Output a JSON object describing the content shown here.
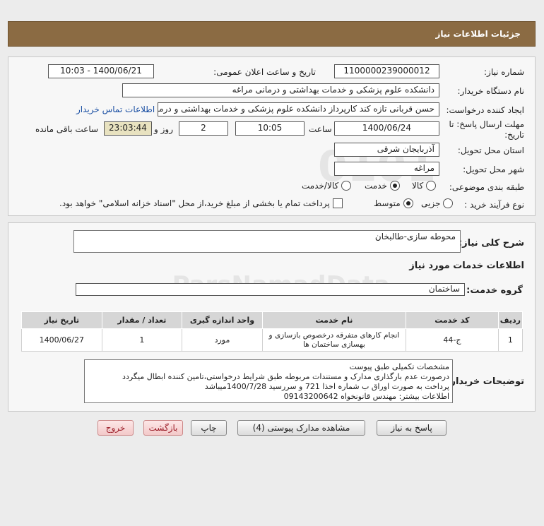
{
  "header": {
    "title": "جزئیات اطلاعات نیاز"
  },
  "form": {
    "need_number": {
      "label": "شماره نیاز:",
      "value": "1100000239000012"
    },
    "announce_date": {
      "label": "تاریخ و ساعت اعلان عمومی:",
      "value": "1400/06/21 - 10:03"
    },
    "buyer_org": {
      "label": "نام دستگاه خریدار:",
      "value": "دانشکده علوم پزشکی و خدمات بهداشتی و درمانی مراغه"
    },
    "requester": {
      "label": "ایجاد کننده درخواست:",
      "value": "حسن قربانی تازه کند کارپرداز دانشکده علوم پزشکی و خدمات بهداشتی و درمانی مراغه",
      "contact_link": "اطلاعات تماس خریدار"
    },
    "deadline": {
      "label": "مهلت ارسال پاسخ: تا تاریخ:",
      "date": "1400/06/24",
      "time_label": "ساعت",
      "time": "10:05",
      "days": "2",
      "days_label": "روز و",
      "remaining": "23:03:44",
      "remaining_label": "ساعت باقی مانده"
    },
    "province": {
      "label": "استان محل تحویل:",
      "value": "آذربایجان شرقی"
    },
    "city": {
      "label": "شهر محل تحویل:",
      "value": "مراغه"
    },
    "category": {
      "label": "طبقه بندی موضوعی:",
      "options": [
        "کالا",
        "خدمت",
        "کالا/خدمت"
      ],
      "selected": "خدمت"
    },
    "process": {
      "label": "نوع فرآیند خرید :",
      "options": [
        "جزیی",
        "متوسط"
      ],
      "selected": "متوسط",
      "payment_note": "پرداخت تمام یا بخشی از مبلغ خرید،از محل \"اسناد خزانه اسلامی\" خواهد بود."
    }
  },
  "description": {
    "label": "شرح کلی نیاز:",
    "value": "محوطه سازی-طالبخان"
  },
  "services": {
    "section_title": "اطلاعات خدمات مورد نیاز",
    "group_label": "گروه خدمت:",
    "group_value": "ساختمان",
    "columns": [
      "ردیف",
      "کد خدمت",
      "نام خدمت",
      "واحد اندازه گیری",
      "تعداد / مقدار",
      "تاریخ نیاز"
    ],
    "rows": [
      {
        "row": "1",
        "code": "ج-44",
        "name": "انجام کارهای متفرقه درخصوص بازسازی و بهسازی ساختمان ها",
        "unit": "مورد",
        "qty": "1",
        "date": "1400/06/27"
      }
    ]
  },
  "buyer_notes": {
    "label": "توضیحات خریدار:",
    "lines": [
      "مشخصات تکمیلی طبق پیوست",
      "درصورت عدم بارگذاری مدارک و مستندات مربوطه طبق شرایط درخواستی،تامین کننده ابطال میگردد",
      "پرداخت به صورت اوراق ب شماره اخذا 721 و سررسید 1400/7/28میباشد",
      "اطلاعات بیشتر: مهندس قانونخواه 09143200642"
    ]
  },
  "buttons": {
    "reply": "پاسخ به نیاز",
    "view_docs": "مشاهده مدارک پیوستی (4)",
    "print": "چاپ",
    "back": "بازگشت",
    "exit": "خروج"
  },
  "colors": {
    "header_bg": "#8b6b43",
    "link": "#1a4fa3",
    "remaining_bg": "#e8e2c0",
    "back_text": "#9c1f2a"
  }
}
